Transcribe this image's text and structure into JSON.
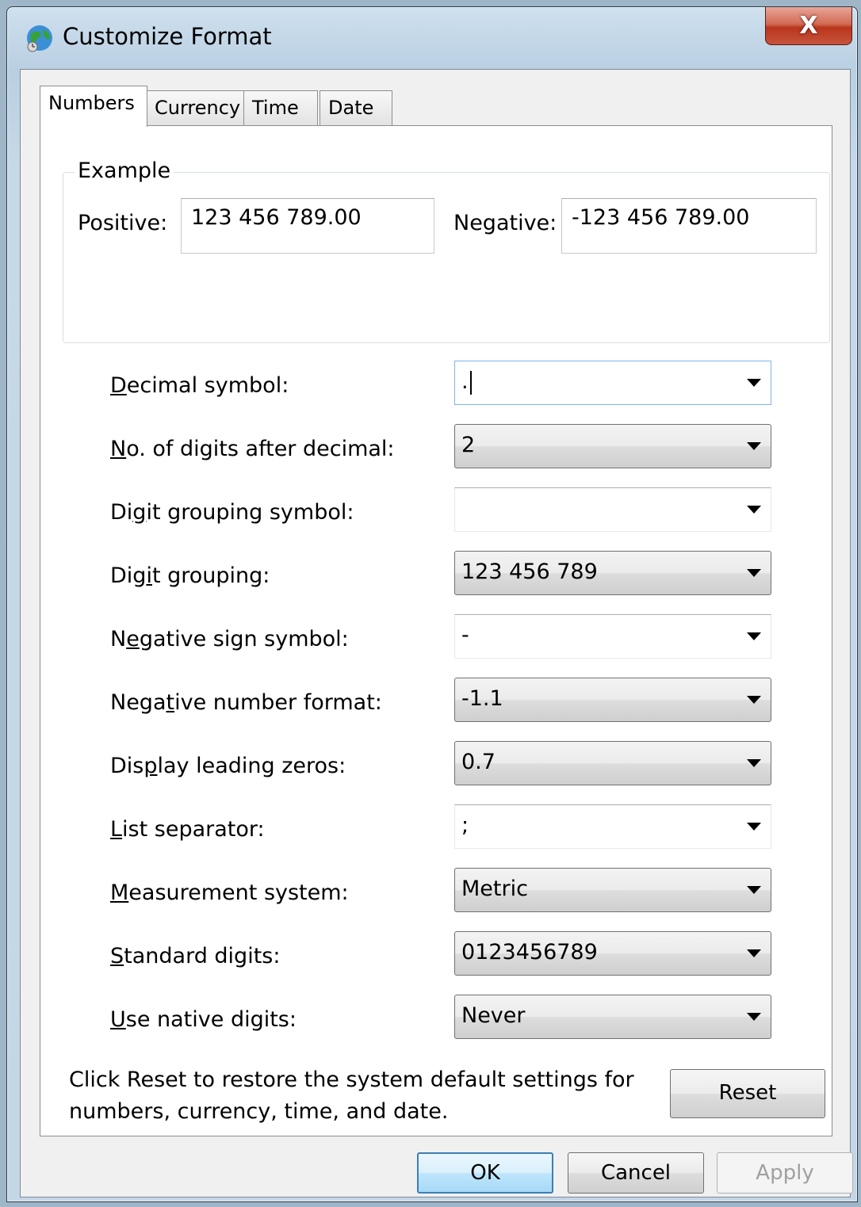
{
  "window": {
    "title": "Customize Format",
    "close_glyph": "X"
  },
  "tabs": [
    {
      "label": "Numbers",
      "active": true
    },
    {
      "label": "Currency",
      "active": false
    },
    {
      "label": "Time",
      "active": false
    },
    {
      "label": "Date",
      "active": false
    }
  ],
  "example": {
    "group_title": "Example",
    "positive_label": "Positive:",
    "positive_value": "123 456 789.00",
    "negative_label": "Negative:",
    "negative_value": "-123 456 789.00"
  },
  "settings": [
    {
      "label": "Decimal symbol:",
      "value": ".",
      "type": "editable"
    },
    {
      "label": "No. of digits after decimal:",
      "value": "2",
      "type": "dropdown"
    },
    {
      "label": "Digit grouping symbol:",
      "value": "",
      "type": "editable"
    },
    {
      "label": "Digit grouping:",
      "value": "123 456 789",
      "type": "dropdown"
    },
    {
      "label": "Negative sign symbol:",
      "value": "-",
      "type": "editable"
    },
    {
      "label": "Negative number format:",
      "value": "-1.1",
      "type": "dropdown"
    },
    {
      "label": "Display leading zeros:",
      "value": "0.7",
      "type": "dropdown"
    },
    {
      "label": "List separator:",
      "value": ";",
      "type": "editable"
    },
    {
      "label": "Measurement system:",
      "value": "Metric",
      "type": "dropdown"
    },
    {
      "label": "Standard digits:",
      "value": "0123456789",
      "type": "dropdown"
    },
    {
      "label": "Use native digits:",
      "value": "Never",
      "type": "dropdown"
    }
  ],
  "reset_note": "Click Reset to restore the system default settings for numbers, currency, time, and date.",
  "buttons": {
    "reset": "Reset",
    "ok": "OK",
    "cancel": "Cancel",
    "apply": "Apply"
  }
}
